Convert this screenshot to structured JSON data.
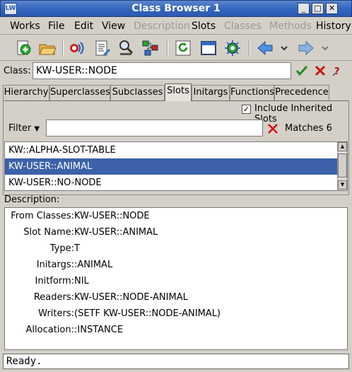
{
  "window": {
    "title": "Class Browser 1",
    "app_icon_text": "LW",
    "buttons": [
      "_",
      "□",
      "✕"
    ]
  },
  "menubar": {
    "items": [
      {
        "label": "Works",
        "enabled": true
      },
      {
        "label": "File",
        "enabled": true
      },
      {
        "label": "Edit",
        "enabled": true
      },
      {
        "label": "View",
        "enabled": true
      },
      {
        "label": "Description",
        "enabled": false
      },
      {
        "label": "Slots",
        "enabled": true
      },
      {
        "label": "Classes",
        "enabled": false
      },
      {
        "label": "Methods",
        "enabled": false
      },
      {
        "label": "History",
        "enabled": true
      }
    ]
  },
  "toolbar": {
    "icons": [
      "new-icon",
      "open-icon",
      "listener-icon",
      "editor-icon",
      "inspector-icon",
      "class-browser-icon",
      "refresh-icon",
      "window-icon",
      "settings-icon",
      "back-icon",
      "back-dropdown-icon",
      "forward-icon",
      "forward-dropdown-icon"
    ]
  },
  "class_row": {
    "label": "Class:",
    "value": "KW-USER::NODE"
  },
  "tabs": [
    {
      "label": "Hierarchy",
      "active": false
    },
    {
      "label": "Superclasses",
      "active": false
    },
    {
      "label": "Subclasses",
      "active": false
    },
    {
      "label": "Slots",
      "active": true
    },
    {
      "label": "Initargs",
      "active": false
    },
    {
      "label": "Functions",
      "active": false
    },
    {
      "label": "Precedence",
      "active": false
    }
  ],
  "slots_panel": {
    "include_inherited_label": "Include Inherited Slots",
    "include_inherited_checked": true,
    "filter_label": "Filter",
    "filter_value": "",
    "matches_text": "Matches 6",
    "list": [
      {
        "label": "KW::ALPHA-SLOT-TABLE",
        "selected": false
      },
      {
        "label": "KW-USER::ANIMAL",
        "selected": true
      },
      {
        "label": "KW-USER::NO-NODE",
        "selected": false
      }
    ]
  },
  "description": {
    "label": "Description:",
    "rows": [
      {
        "key": "From Classes:",
        "value": "KW-USER::NODE"
      },
      {
        "key": "Slot Name:",
        "value": "KW-USER::ANIMAL"
      },
      {
        "key": "Type:",
        "value": "T"
      },
      {
        "key": "Initargs:",
        "value": ":ANIMAL"
      },
      {
        "key": "Initform:",
        "value": "NIL"
      },
      {
        "key": "Readers:",
        "value": "KW-USER::NODE-ANIMAL"
      },
      {
        "key": "Writers:",
        "value": "(SETF KW-USER::NODE-ANIMAL)"
      },
      {
        "key": "Allocation:",
        "value": ":INSTANCE"
      }
    ]
  },
  "status": {
    "text": "Ready."
  },
  "colors": {
    "titlebar": "#3567c0",
    "selection": "#3c61a8",
    "accept": "#1f8a1f",
    "cancel": "#d01010"
  }
}
